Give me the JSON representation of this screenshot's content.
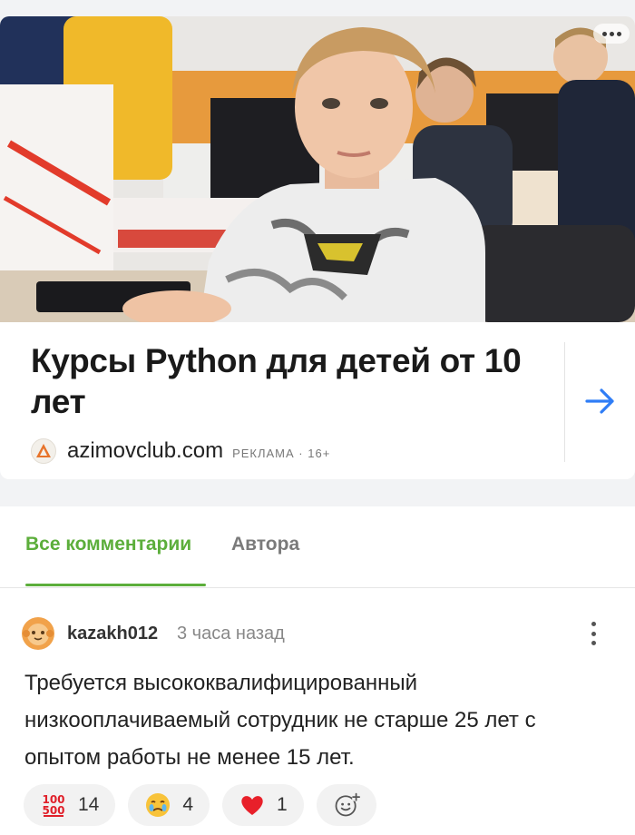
{
  "ad": {
    "title": "Курсы Python для детей от 10 лет",
    "site": "azimovclub.com",
    "label": "РЕКЛАМА · 16+",
    "image_icon": "photo-kids-at-computers",
    "arrow_icon": "arrow-right-icon",
    "arrow_color": "#2f7df6"
  },
  "tabs": [
    {
      "label": "Все комментарии",
      "active": true
    },
    {
      "label": "Автора",
      "active": false
    }
  ],
  "accent_color": "#5cae3b",
  "comment": {
    "username": "kazakh012",
    "time": "3 часа назад",
    "text": "Требуется высококвалифицированный низкооплачиваемый сотрудник не старше 25 лет с опытом работы не менее 15 лет.",
    "reactions": [
      {
        "icon": "hundred-points-emoji",
        "count": "14"
      },
      {
        "icon": "crying-face-emoji",
        "count": "4"
      },
      {
        "icon": "red-heart-emoji",
        "count": "1"
      }
    ],
    "add_reaction_icon": "add-reaction-icon"
  }
}
